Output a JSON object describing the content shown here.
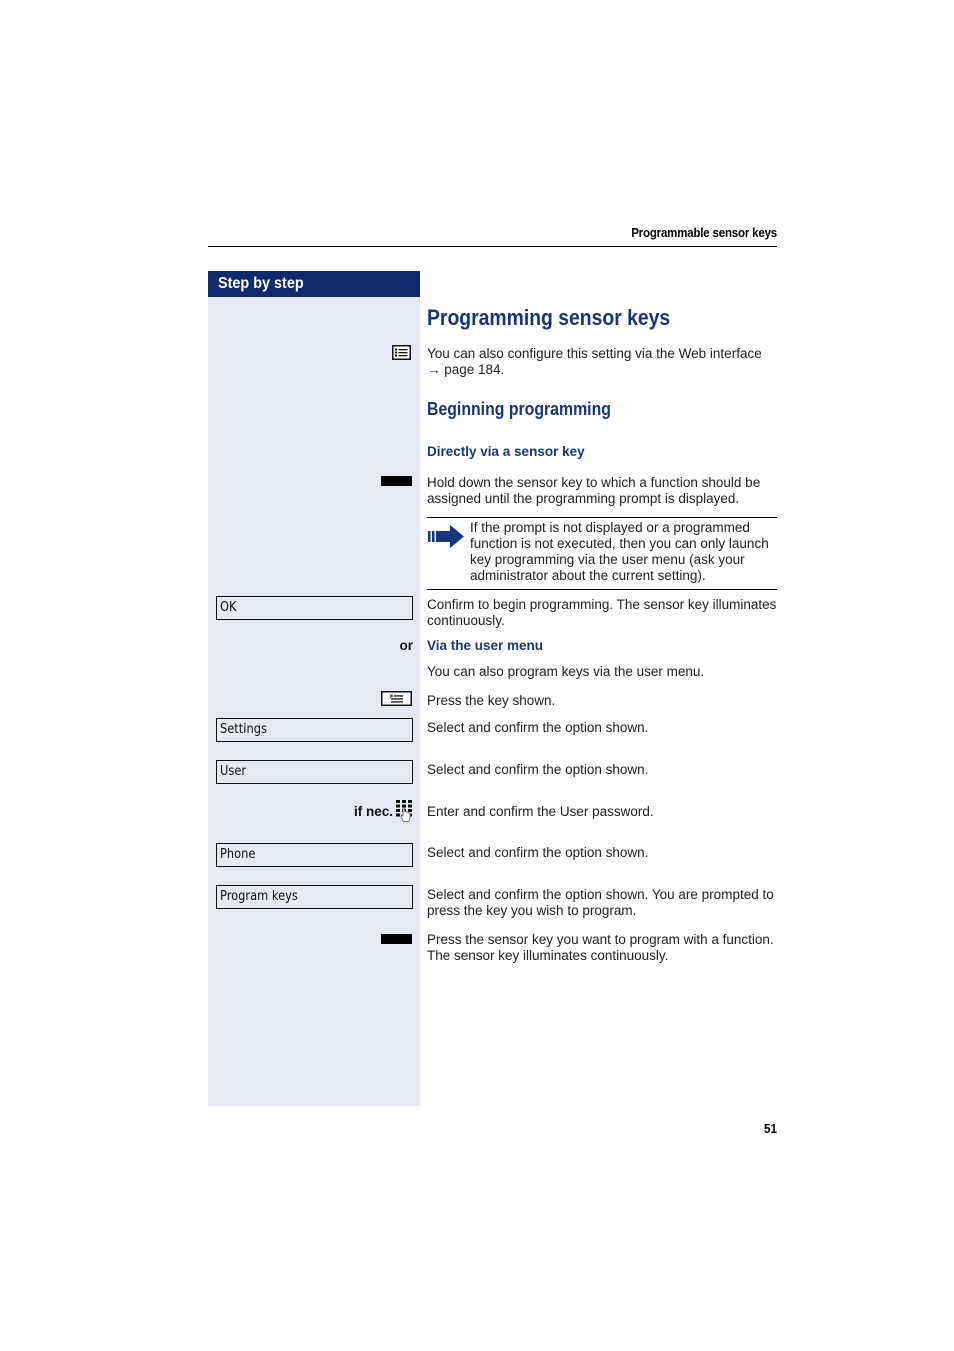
{
  "header": {
    "running_title": "Programmable sensor keys",
    "page_number": "51"
  },
  "sidebar": {
    "title": "Step by step"
  },
  "main": {
    "title": "Programming sensor keys",
    "web_note": "You can also configure this setting via the Web interface",
    "web_ref": "→ page 184.",
    "section": "Beginning programming",
    "direct": {
      "heading": "Directly via a sensor key",
      "hold_text": "Hold down the sensor key to which a function should be assigned until the programming prompt is displayed.",
      "note": "If the prompt is not displayed or a programmed function is not executed, then you can only launch key programming via the user menu (ask your administrator about the current setting).",
      "confirm_text": "Confirm to begin programming. The sensor key illuminates continuously."
    },
    "or_label": "or",
    "user_menu": {
      "heading": "Via the user menu",
      "intro": "You can also program keys via the user menu.",
      "press_key": "Press the key shown.",
      "select_confirm": "Select and confirm the option shown.",
      "if_nec_label": "if nec.",
      "enter_password": "Enter and confirm the User password.",
      "program_keys_text": "Select and confirm the option shown. You are prompted to press the key you wish to program.",
      "press_sensor_text": "Press the sensor key you want to program with a function. The sensor key illuminates continuously."
    }
  },
  "menu_options": {
    "ok": "OK",
    "settings": "Settings",
    "user": "User",
    "phone": "Phone",
    "program_keys": "Program keys"
  },
  "icons": {
    "web_interface": "web-interface-icon",
    "sensor_key": "sensor-key-icon",
    "note_arrow": "note-arrow-icon",
    "menu_key": "menu-key-icon",
    "keypad": "keypad-icon"
  },
  "colors": {
    "accent": "#1a3580",
    "header_bg": "#0f2a6e",
    "sidebar_bg": "#e6e9f3"
  }
}
